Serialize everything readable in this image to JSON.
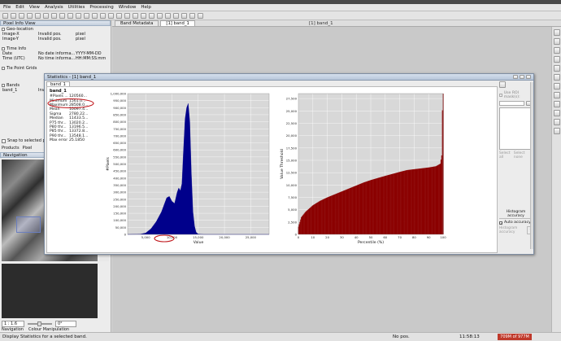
{
  "menu": [
    "File",
    "Edit",
    "View",
    "Analysis",
    "Utilities",
    "Processing",
    "Window",
    "Help"
  ],
  "editor_tabs": [
    {
      "label": "Band Metadata",
      "active": false
    },
    {
      "label": "[1] band_1",
      "active": true
    }
  ],
  "editor_title": "[1] band_1",
  "pixel_info": {
    "title": "Pixel Info View",
    "geo_header": "Geo-location",
    "geo_rows": [
      {
        "k": "Image-X",
        "v": "Invalid pos.",
        "u": "pixel"
      },
      {
        "k": "Image-Y",
        "v": "Invalid pos.",
        "u": "pixel"
      }
    ],
    "time_header": "Time Info",
    "time_rows": [
      {
        "k": "Date",
        "v": "No date informa...",
        "u": "YYYY-MM-DD"
      },
      {
        "k": "Time (UTC)",
        "v": "No time informa...",
        "u": "HH:MM:SS:mm"
      }
    ],
    "tiepoint_header": "Tie Point Grids",
    "bands_header": "Bands",
    "band_rows": [
      {
        "k": "band_1",
        "v": "Inv"
      }
    ],
    "snap_label": "Snap to selected pi",
    "bottom_tabs": [
      "Products",
      "Pixel"
    ]
  },
  "navigation": {
    "title": "Navigation",
    "zoom": "1 : 1.6",
    "rotation": "0°",
    "bottom_tabs": [
      "Navigation",
      "Colour Manipulation"
    ]
  },
  "statistics": {
    "title": "Statistics - [1] band_1",
    "band_tab": "band_1",
    "band_name": "band_1",
    "rows": [
      {
        "k": "#Pixels ...",
        "v": "120560..."
      },
      {
        "k": "Minimum",
        "v": "1561.0..."
      },
      {
        "k": "Maximum",
        "v": "28508.0..."
      },
      {
        "k": "Mean",
        "v": "10097.4..."
      },
      {
        "k": "Sigma",
        "v": "2780.22..."
      },
      {
        "k": "Median",
        "v": "11433.5..."
      },
      {
        "k": "P75 thr...",
        "v": "13020.2..."
      },
      {
        "k": "P80 thr...",
        "v": "13196.5..."
      },
      {
        "k": "P85 thr...",
        "v": "13372.8..."
      },
      {
        "k": "P90 thr...",
        "v": "13548.1..."
      },
      {
        "k": "Max error",
        "v": "25.1850"
      }
    ],
    "side": {
      "roi_label": "Use ROI mask(s):",
      "select_all": "Select all",
      "select_none": "Select none",
      "accuracy_header": "Histogram accuracy",
      "auto_accuracy": "Auto accuracy",
      "accuracy_label": "Histogram accuracy",
      "accuracy_value": "3"
    }
  },
  "chart_data": [
    {
      "type": "area",
      "title": "",
      "xlabel": "Value",
      "ylabel": "#Pixels",
      "xlim": [
        1561,
        28508
      ],
      "ylim": [
        0,
        1000000
      ],
      "xticks": [
        "5,000",
        "10,000",
        "15,000",
        "20,000",
        "25,000"
      ],
      "xtick_values": [
        5000,
        10000,
        15000,
        20000,
        25000
      ],
      "yticks": [
        "0",
        "50,000",
        "100,000",
        "150,000",
        "200,000",
        "250,000",
        "300,000",
        "350,000",
        "400,000",
        "450,000",
        "500,000",
        "550,000",
        "600,000",
        "650,000",
        "700,000",
        "750,000",
        "800,000",
        "850,000",
        "900,000",
        "950,000",
        "1,000,000"
      ],
      "x": [
        1561,
        4000,
        5000,
        6000,
        7000,
        8000,
        8500,
        9000,
        9500,
        10000,
        10500,
        11000,
        11300,
        11600,
        11900,
        12200,
        12500,
        12800,
        13100,
        13400,
        13700,
        14000,
        14300,
        14600,
        15000,
        16000,
        28508
      ],
      "y": [
        0,
        2000,
        10000,
        40000,
        90000,
        160000,
        210000,
        260000,
        270000,
        235000,
        220000,
        300000,
        330000,
        310000,
        360000,
        600000,
        820000,
        900000,
        930000,
        800000,
        430000,
        160000,
        60000,
        15000,
        3000,
        0,
        0
      ],
      "color": "#00008b"
    },
    {
      "type": "bar",
      "title": "",
      "xlabel": "Percentile (%)",
      "ylabel": "Value Threshold",
      "xlim": [
        0,
        100
      ],
      "ylim": [
        0,
        28508
      ],
      "xticks": [
        "0",
        "10",
        "20",
        "30",
        "40",
        "50",
        "60",
        "70",
        "80",
        "90",
        "100"
      ],
      "yticks": [
        "0",
        "2,500",
        "5,000",
        "7,500",
        "10,000",
        "12,500",
        "15,000",
        "17,500",
        "20,000",
        "22,500",
        "25,000",
        "27,500"
      ],
      "percentile": [
        0,
        2,
        5,
        10,
        15,
        20,
        25,
        30,
        35,
        40,
        45,
        50,
        55,
        60,
        65,
        70,
        75,
        80,
        85,
        90,
        95,
        98,
        99,
        99.6,
        100
      ],
      "threshold": [
        1561,
        3500,
        4600,
        5900,
        6800,
        7500,
        8100,
        8700,
        9300,
        9900,
        10500,
        11000,
        11430,
        11850,
        12250,
        12650,
        13020,
        13200,
        13370,
        13550,
        13800,
        14300,
        16000,
        27000,
        28508
      ],
      "color": "#8b0000"
    }
  ],
  "status": {
    "message": "Display Statistics for a selected band.",
    "position": "No pos.",
    "time": "11:58:13",
    "memory": "709M of 977M"
  }
}
